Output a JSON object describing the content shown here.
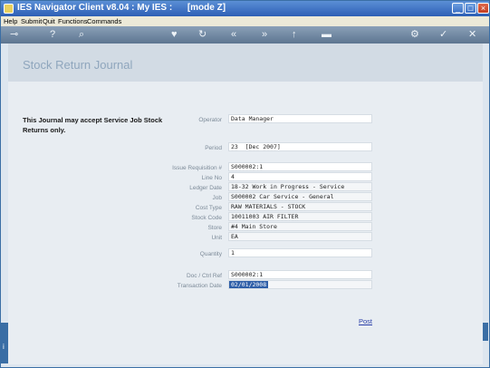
{
  "window": {
    "title": "IES Navigator Client v8.04 : My IES :      [mode Z]"
  },
  "menubar": {
    "items": [
      "Help",
      "Submit",
      "Quit",
      "Functions",
      "Commands"
    ]
  },
  "toolbar": {
    "icons": [
      "key-icon",
      "help-icon",
      "search-icon",
      "heart-icon",
      "refresh-icon",
      "rewind-icon",
      "fast-forward-icon",
      "upload-icon",
      "minus-icon",
      "gear-icon",
      "check-icon",
      "close-icon"
    ]
  },
  "page": {
    "title": "Stock Return Journal",
    "note": "This Journal may accept Service Job Stock Returns only."
  },
  "form": {
    "operator": {
      "label": "Operator",
      "value": "Data Manager"
    },
    "period": {
      "label": "Period",
      "value": "23  [Dec 2007]"
    },
    "issue_req": {
      "label": "Issue Requisition #",
      "value": "S000002:1"
    },
    "line_no": {
      "label": "Line No",
      "value": "4"
    },
    "ledger_date": {
      "label": "Ledger Date",
      "value": "18-32 Work in Progress - Service"
    },
    "job": {
      "label": "Job",
      "value": "S000002 Car Service - General"
    },
    "cost_type": {
      "label": "Cost Type",
      "value": "RAW MATERIALS - STOCK"
    },
    "stock_code": {
      "label": "Stock Code",
      "value": "10011003 AIR FILTER"
    },
    "store": {
      "label": "Store",
      "value": "#4 Main Store"
    },
    "unit": {
      "label": "Unit",
      "value": "EA"
    },
    "quantity": {
      "label": "Quantity",
      "value": "1"
    },
    "doc_ref": {
      "label": "Doc / Ctrl Ref",
      "value": "S000002:1"
    },
    "transaction_date": {
      "label": "Transaction Date",
      "value": "02/01/2008"
    }
  },
  "actions": {
    "post_label": "Post"
  }
}
